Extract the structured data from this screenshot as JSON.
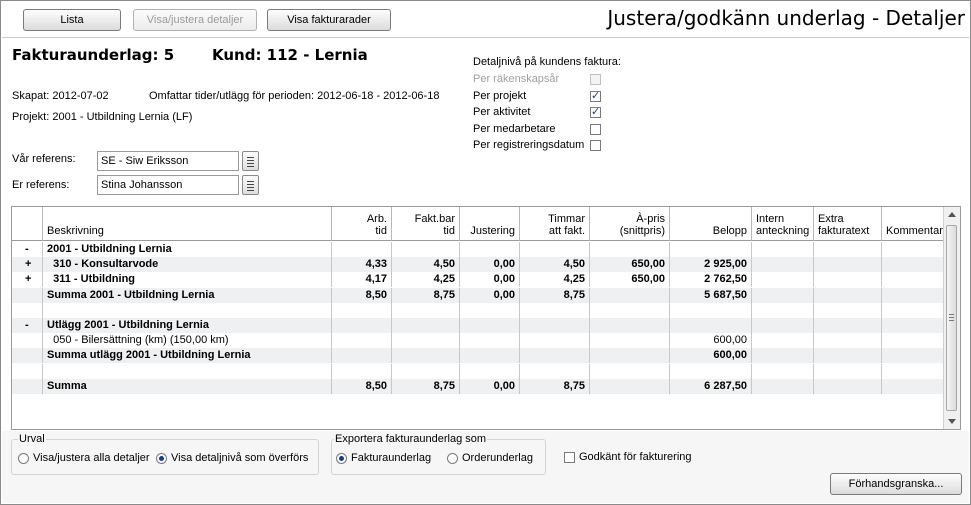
{
  "toolbar": {
    "lista": "Lista",
    "visa_justera": "Visa/justera detaljer",
    "visa_fakturarader": "Visa fakturarader"
  },
  "page_title": "Justera/godkänn underlag - Detaljer",
  "invoice": {
    "fakturaunderlag": "Fakturaunderlag: 5",
    "kund": "Kund: 112 - Lernia",
    "skapat": "Skapat: 2012-07-02",
    "omfattar": "Omfattar tider/utlägg för perioden: 2012-06-18 - 2012-06-18",
    "projekt": "Projekt: 2001 - Utbildning Lernia (LF)"
  },
  "detail_level": {
    "heading": "Detaljnivå på kundens faktura:",
    "options": [
      {
        "label": "Per räkenskapsår",
        "checked": false,
        "disabled": true
      },
      {
        "label": "Per projekt",
        "checked": true,
        "disabled": false
      },
      {
        "label": "Per aktivitet",
        "checked": true,
        "disabled": false
      },
      {
        "label": "Per medarbetare",
        "checked": false,
        "disabled": false
      },
      {
        "label": "Per registreringsdatum",
        "checked": false,
        "disabled": false
      }
    ]
  },
  "references": {
    "var_label": "Vår referens:",
    "var_value": "SE - Siw Eriksson",
    "er_label": "Er referens:",
    "er_value": "Stina Johansson"
  },
  "grid": {
    "columns": [
      {
        "key": "exp",
        "label": ""
      },
      {
        "key": "desc",
        "label": "Beskrivning"
      },
      {
        "key": "arb",
        "label": "Arb.\ntid"
      },
      {
        "key": "fakt",
        "label": "Fakt.bar\ntid"
      },
      {
        "key": "just",
        "label": "Justering"
      },
      {
        "key": "tim",
        "label": "Timmar\natt fakt."
      },
      {
        "key": "apris",
        "label": "À-pris\n(snittpris)"
      },
      {
        "key": "bel",
        "label": "Belopp"
      },
      {
        "key": "intern",
        "label": "Intern\nanteckning"
      },
      {
        "key": "extra",
        "label": "Extra\nfakturatext"
      },
      {
        "key": "komm",
        "label": "Kommentar"
      }
    ],
    "rows": [
      {
        "exp": "-",
        "desc": "2001 - Utbildning Lernia",
        "bold": true,
        "arb": "",
        "fakt": "",
        "just": "",
        "tim": "",
        "apris": "",
        "bel": ""
      },
      {
        "exp": "+",
        "desc": "  310 - Konsultarvode",
        "bold": true,
        "arb": "4,33",
        "fakt": "4,50",
        "just": "0,00",
        "tim": "4,50",
        "apris": "650,00",
        "bel": "2 925,00"
      },
      {
        "exp": "+",
        "desc": "  311 - Utbildning",
        "bold": true,
        "arb": "4,17",
        "fakt": "4,25",
        "just": "0,00",
        "tim": "4,25",
        "apris": "650,00",
        "bel": "2 762,50"
      },
      {
        "exp": "",
        "desc": "Summa 2001 - Utbildning Lernia",
        "bold": true,
        "arb": "8,50",
        "fakt": "8,75",
        "just": "0,00",
        "tim": "8,75",
        "apris": "",
        "bel": "5 687,50"
      },
      {
        "exp": "",
        "desc": "",
        "bold": false,
        "arb": "",
        "fakt": "",
        "just": "",
        "tim": "",
        "apris": "",
        "bel": ""
      },
      {
        "exp": "-",
        "desc": "Utlägg 2001 - Utbildning Lernia",
        "bold": true,
        "arb": "",
        "fakt": "",
        "just": "",
        "tim": "",
        "apris": "",
        "bel": ""
      },
      {
        "exp": "",
        "desc": "  050 - Bilersättning (km) (150,00 km)",
        "bold": false,
        "arb": "",
        "fakt": "",
        "just": "",
        "tim": "",
        "apris": "",
        "bel": "600,00"
      },
      {
        "exp": "",
        "desc": "Summa utlägg 2001 - Utbildning Lernia",
        "bold": true,
        "arb": "",
        "fakt": "",
        "just": "",
        "tim": "",
        "apris": "",
        "bel": "600,00"
      },
      {
        "exp": "",
        "desc": "",
        "bold": false,
        "arb": "",
        "fakt": "",
        "just": "",
        "tim": "",
        "apris": "",
        "bel": ""
      },
      {
        "exp": "",
        "desc": "Summa",
        "bold": true,
        "arb": "8,50",
        "fakt": "8,75",
        "just": "0,00",
        "tim": "8,75",
        "apris": "",
        "bel": "6 287,50"
      }
    ]
  },
  "urval": {
    "legend": "Urval",
    "opt1": "Visa/justera alla detaljer",
    "opt2": "Visa detaljnivå som överförs",
    "selected": 2
  },
  "exportera": {
    "legend": "Exportera fakturaunderlag som",
    "opt1": "Fakturaunderlag",
    "opt2": "Orderunderlag",
    "selected": 1
  },
  "godkant": {
    "label": "Godkänt för fakturering",
    "checked": false
  },
  "preview_button": "Förhandsgranska..."
}
